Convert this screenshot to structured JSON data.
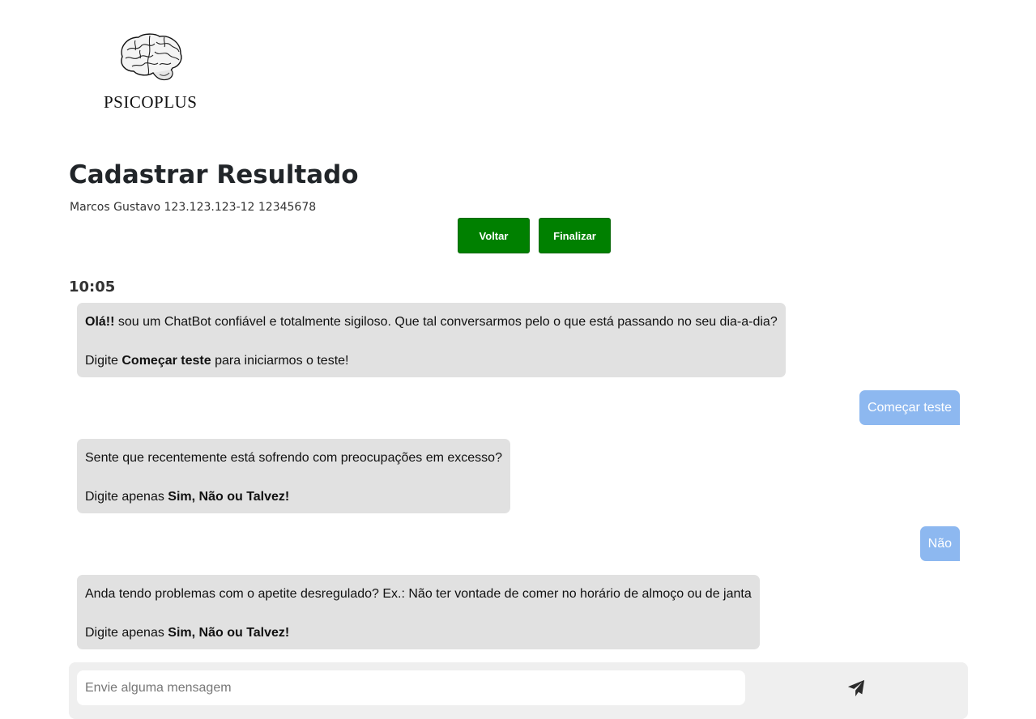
{
  "brand": {
    "name": "PSICOPLUS",
    "logo_icon": "brain-icon"
  },
  "page": {
    "title": "Cadastrar Resultado",
    "patient_info": "Marcos Gustavo 123.123.123-12 12345678"
  },
  "actions": {
    "back_label": "Voltar",
    "finish_label": "Finalizar",
    "button_color": "#008000"
  },
  "chat": {
    "time": "10:05",
    "messages": [
      {
        "from": "bot",
        "line1_bold": "Olá!!",
        "line1_text": " sou um ChatBot confiável e totalmente sigiloso. Que tal conversarmos pelo o que está passando no seu dia-a-dia?",
        "line2_prefix": "Digite ",
        "line2_bold": "Começar teste",
        "line2_suffix": " para iniciarmos o teste!"
      },
      {
        "from": "user",
        "text": "Começar teste"
      },
      {
        "from": "bot",
        "line1_text": "Sente que recentemente está sofrendo com preocupações em excesso?",
        "line2_prefix": "Digite apenas ",
        "line2_bold": "Sim, Não ou Talvez!"
      },
      {
        "from": "user",
        "text": "Não"
      },
      {
        "from": "bot",
        "line1_text": "Anda tendo problemas com o apetite desregulado? Ex.: Não ter vontade de comer no horário de almoço ou de janta",
        "line2_prefix": "Digite apenas ",
        "line2_bold": "Sim, Não ou Talvez!"
      }
    ],
    "bot_bubble_color": "#e1e1e1",
    "user_bubble_color": "#8db8f0"
  },
  "composer": {
    "placeholder": "Envie alguma mensagem",
    "value": "",
    "send_icon": "send-icon"
  }
}
